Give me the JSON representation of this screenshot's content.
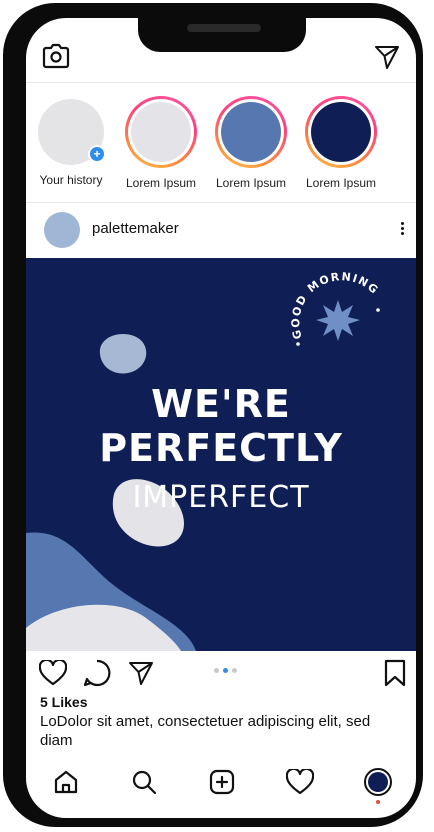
{
  "stories": [
    {
      "label": "Your history",
      "color": "#e4e4e6"
    },
    {
      "label": "Lorem Ipsum",
      "color": "#e4e4e8"
    },
    {
      "label": "Lorem Ipsum",
      "color": "#5677b0"
    },
    {
      "label": "Lorem Ipsum",
      "color": "#0f1f56"
    }
  ],
  "post": {
    "username": "palettemaker",
    "image": {
      "badge_text": "GOOD MORNING",
      "line1": "WE'RE",
      "line2": "PERFECTLY",
      "line3": "IMPERFECT",
      "bg_color": "#0f1f56",
      "accent_color": "#5677b0"
    },
    "carousel": {
      "count": 3,
      "active_index": 1
    },
    "likes": "5 Likes",
    "caption": "LoDolor sit amet, consectetuer adipiscing elit, sed diam"
  },
  "icons": {
    "top_left": "camera-icon",
    "top_right": "send-icon",
    "actions": [
      "heart-icon",
      "comment-icon",
      "send-icon",
      "bookmark-icon"
    ],
    "nav": [
      "home-icon",
      "search-icon",
      "add-icon",
      "heart-icon",
      "profile-icon"
    ]
  }
}
